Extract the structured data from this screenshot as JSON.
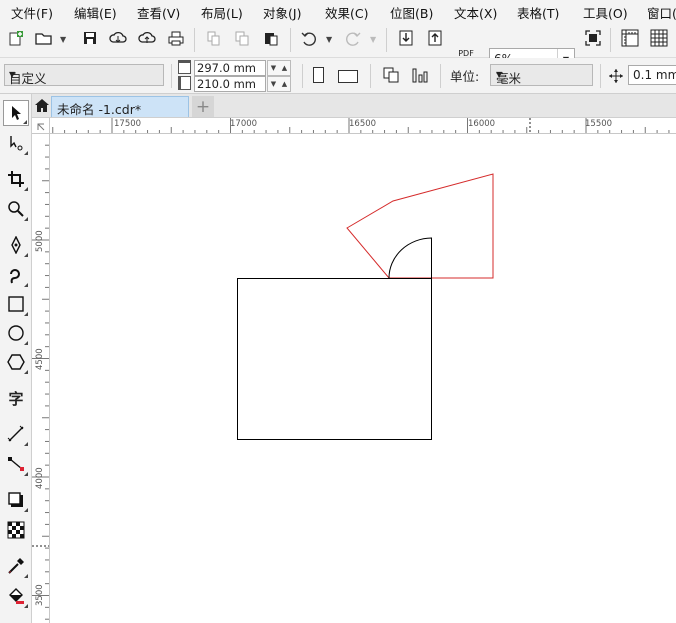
{
  "menu": {
    "items": [
      "文件(F)",
      "编辑(E)",
      "查看(V)",
      "布局(L)",
      "对象(J)",
      "效果(C)",
      "位图(B)",
      "文本(X)",
      "表格(T)",
      "工具(O)",
      "窗口("
    ]
  },
  "toolbar": {
    "zoom": "6%",
    "pdf_label": "PDF"
  },
  "property_bar": {
    "preset": "自定义",
    "width": "297.0 mm",
    "height": "210.0 mm",
    "unit_label": "单位:",
    "unit_value": "毫米",
    "nudge": "0.1 mm"
  },
  "document": {
    "tab_title": "未命名 -1.cdr*"
  },
  "rulers": {
    "horizontal_labels": [
      "17500",
      "17000",
      "16500",
      "16000",
      "15500"
    ],
    "vertical_labels": [
      "5000",
      "4500",
      "4000",
      "3500"
    ]
  },
  "colors": {
    "selection_outline": "#d52b2b",
    "shape_outline": "#000000",
    "tab_active": "#cde3f7"
  }
}
